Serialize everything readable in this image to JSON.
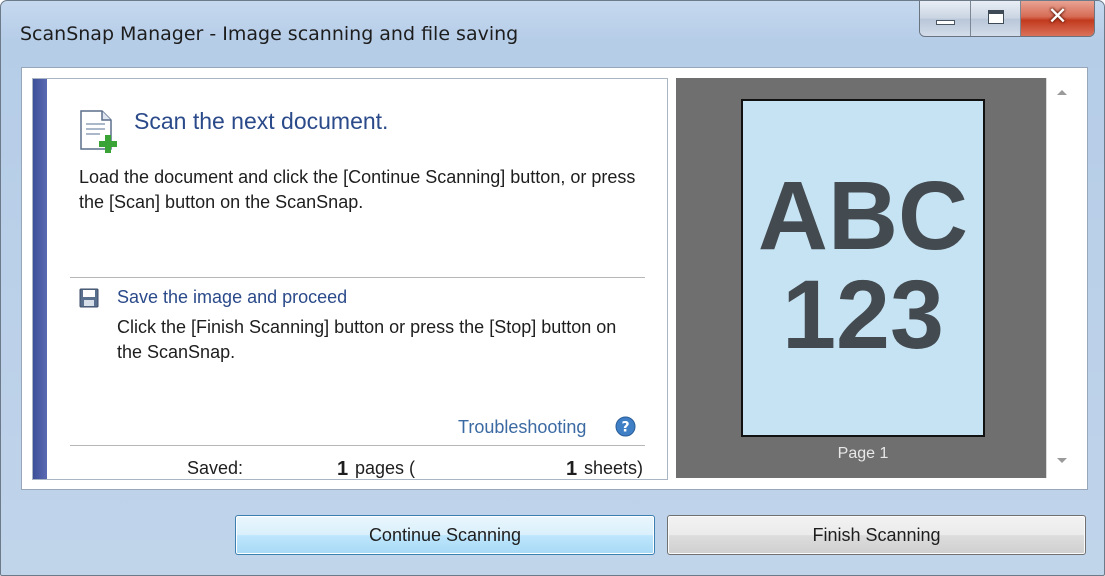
{
  "window": {
    "title": "ScanSnap Manager - Image scanning and file saving"
  },
  "instructions": {
    "heading": "Scan the next document.",
    "body": "Load the document and click the [Continue Scanning] button, or press the [Scan] button on the ScanSnap.",
    "save_title": "Save the image and proceed",
    "save_body": "Click the [Finish Scanning] button or press the [Stop] button on the ScanSnap.",
    "troubleshooting": "Troubleshooting"
  },
  "status": {
    "saved_label": "Saved:",
    "pages_count": "1",
    "pages_unit": "pages (",
    "sheets_count": "1",
    "sheets_unit": "sheets)"
  },
  "preview": {
    "thumbnail_line1": "ABC",
    "thumbnail_line2": "123",
    "page_label": "Page 1"
  },
  "buttons": {
    "continue": "Continue Scanning",
    "finish": "Finish Scanning"
  },
  "colors": {
    "accent_bar": "#4a5aa6",
    "link": "#2b4a8a",
    "thumbnail_bg": "#c6e3f3",
    "preview_bg": "#6f6f6f"
  },
  "icons": {
    "document": "document-plus-icon",
    "save": "floppy-disk-icon",
    "help": "help-question-icon"
  }
}
